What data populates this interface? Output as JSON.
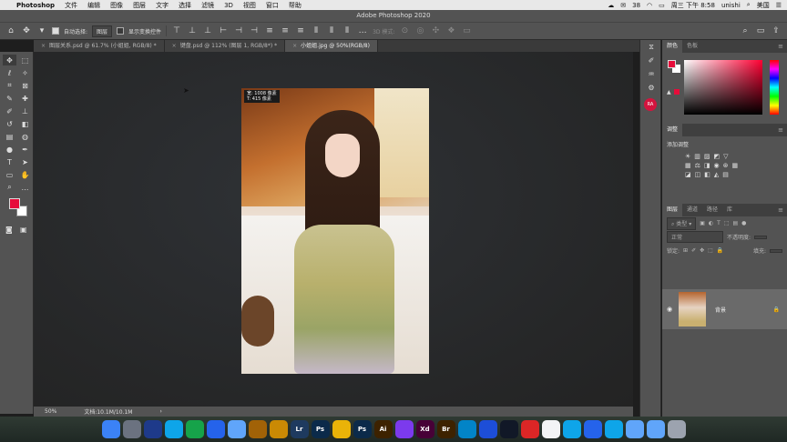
{
  "menubar": {
    "app": "Photoshop",
    "items": [
      "文件",
      "编辑",
      "图像",
      "图层",
      "文字",
      "选择",
      "滤镜",
      "3D",
      "视图",
      "窗口",
      "帮助"
    ],
    "right": {
      "badge": "38",
      "datetime": "周三 下午 8:58",
      "user": "unishi",
      "input": "美国"
    }
  },
  "titlebar": {
    "title": "Adobe Photoshop 2020"
  },
  "optbar": {
    "auto_select_label": "自动选择:",
    "auto_select_value": "图层",
    "show_transform_label": "显示变换控件",
    "mode_3d_label": "3D 模式:"
  },
  "tabs": [
    {
      "label": "图层关系.psd @ 61.7% (小姐姐, RGB/8) *",
      "active": false
    },
    {
      "label": "键盘.psd @ 112% (图层 1, RGB/8*) *",
      "active": false
    },
    {
      "label": "小姐姐.jpg @ 50%(RGB/8)",
      "active": true
    }
  ],
  "canvas": {
    "size_w": "宽: 1008 像素",
    "size_h": "T: 415 像素"
  },
  "status": {
    "zoom": "50%",
    "doc": "文档:10.1M/10.1M"
  },
  "colors": {
    "foreground": "#e60c3a",
    "background": "#ffffff",
    "ui_bg": "#535353"
  },
  "color_panel": {
    "tabs": [
      "颜色",
      "色板"
    ]
  },
  "adjust_panel": {
    "tab": "调整",
    "add_label": "添加调整"
  },
  "layers_panel": {
    "tabs": [
      "图层",
      "通道",
      "路径",
      "库"
    ],
    "filter": "类型",
    "blend": "正常",
    "opacity_label": "不透明度:",
    "lock_label": "锁定:",
    "fill_label": "填充:",
    "layer_name": "背景"
  },
  "iconcol": {
    "avatar": "RA"
  },
  "dock": {
    "apps": [
      {
        "label": "",
        "color": "#3b82f6",
        "name": "finder-icon"
      },
      {
        "label": "",
        "color": "#6b7280",
        "name": "launchpad-icon"
      },
      {
        "label": "",
        "color": "#1e3a8a",
        "name": "qq-browser-icon"
      },
      {
        "label": "",
        "color": "#0ea5e9",
        "name": "safari-icon"
      },
      {
        "label": "",
        "color": "#16a34a",
        "name": "chrome-icon"
      },
      {
        "label": "",
        "color": "#2563eb",
        "name": "edge-icon"
      },
      {
        "label": "",
        "color": "#60a5fa",
        "name": "baidu-icon"
      },
      {
        "label": "",
        "color": "#a16207",
        "name": "preview-icon"
      },
      {
        "label": "",
        "color": "#ca8a04",
        "name": "notes-icon"
      },
      {
        "label": "Lr",
        "color": "#1e3a5f",
        "name": "lightroom-icon"
      },
      {
        "label": "Ps",
        "color": "#0b2a4a",
        "name": "photoshop-icon"
      },
      {
        "label": "",
        "color": "#eab308",
        "name": "sketch-icon"
      },
      {
        "label": "Ps",
        "color": "#0b2a4a",
        "name": "photoshop-2-icon"
      },
      {
        "label": "Ai",
        "color": "#3d2200",
        "name": "illustrator-icon"
      },
      {
        "label": "",
        "color": "#7c3aed",
        "name": "palette-icon"
      },
      {
        "label": "Xd",
        "color": "#470137",
        "name": "xd-icon"
      },
      {
        "label": "Br",
        "color": "#3d2200",
        "name": "bridge-icon"
      },
      {
        "label": "",
        "color": "#0284c7",
        "name": "q-icon"
      },
      {
        "label": "",
        "color": "#1d4ed8",
        "name": "word-icon"
      },
      {
        "label": "",
        "color": "#111827",
        "name": "qq-icon"
      },
      {
        "label": "",
        "color": "#dc2626",
        "name": "powerpoint-icon"
      },
      {
        "label": "",
        "color": "#f3f4f6",
        "name": "wps-icon"
      },
      {
        "label": "",
        "color": "#0ea5e9",
        "name": "weibo-icon"
      },
      {
        "label": "",
        "color": "#2563eb",
        "name": "mountain-icon"
      },
      {
        "label": "",
        "color": "#0ea5e9",
        "name": "bird-icon"
      },
      {
        "label": "",
        "color": "#60a5fa",
        "name": "folder-icon"
      },
      {
        "label": "",
        "color": "#60a5fa",
        "name": "downloads-icon"
      },
      {
        "label": "",
        "color": "#9ca3af",
        "name": "trash-icon"
      }
    ]
  }
}
